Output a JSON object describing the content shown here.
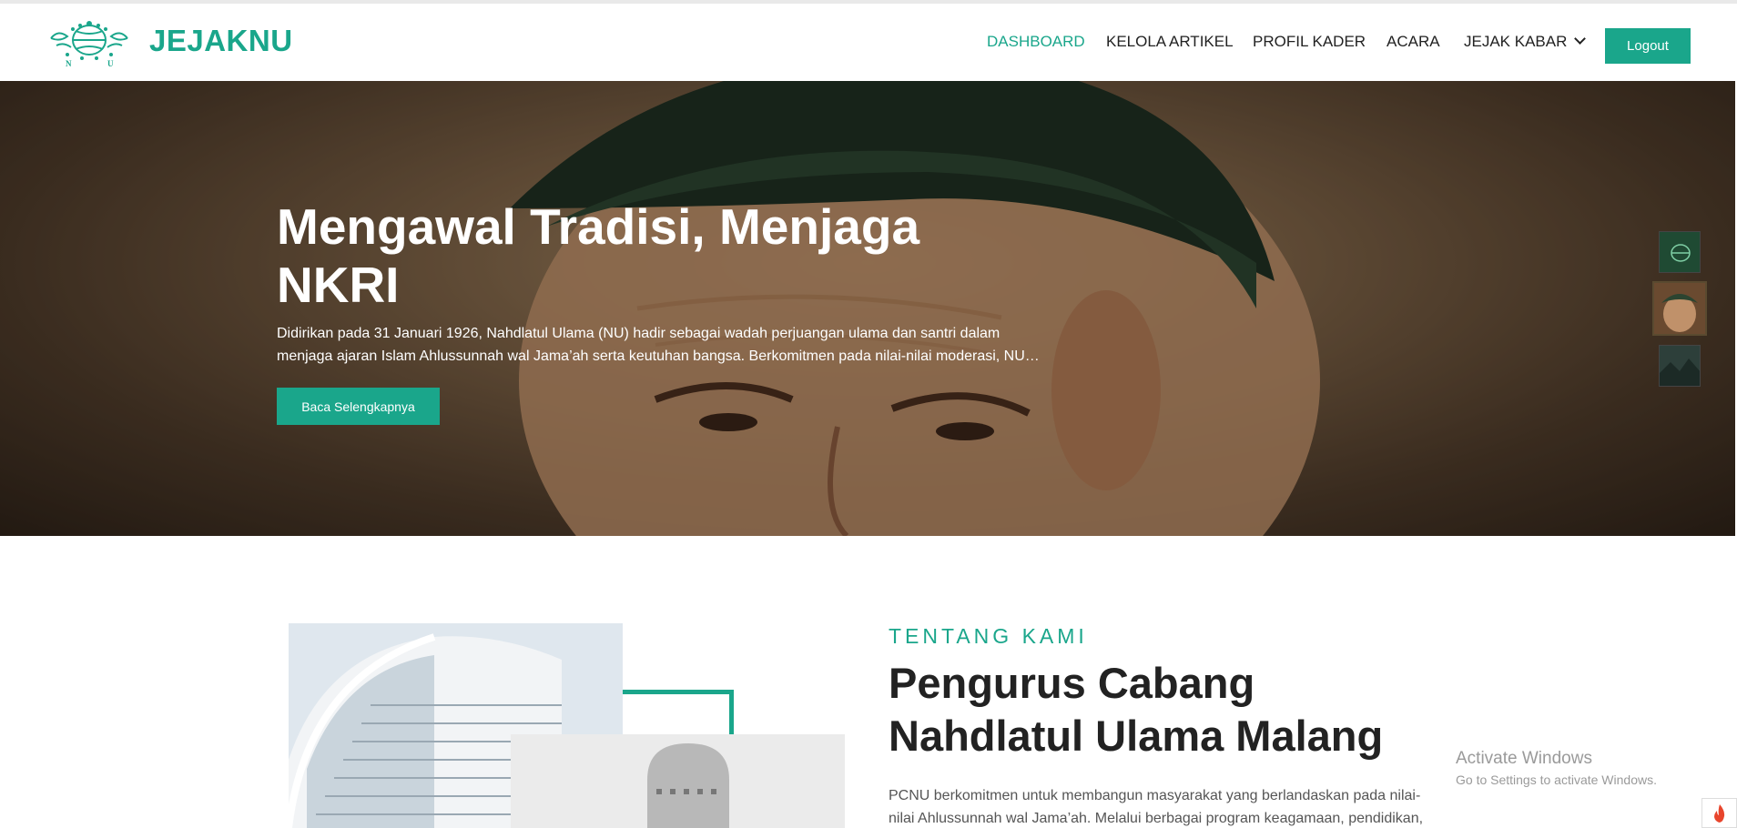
{
  "navbar": {
    "brand": "JEJAKNU",
    "logo_icon": "nu-logo-icon",
    "items": [
      {
        "label": "DASHBOARD",
        "active": true
      },
      {
        "label": "KELOLA ARTIKEL",
        "active": false
      },
      {
        "label": "PROFIL KADER",
        "active": false
      },
      {
        "label": "ACARA",
        "active": false
      },
      {
        "label": "JEJAK KABAR",
        "active": false,
        "icon": "chevron-down-icon"
      }
    ],
    "logout_label": "Logout"
  },
  "hero": {
    "title": "Mengawal Tradisi, Menjaga NKRI",
    "description": "Didirikan pada 31 Januari 1926, Nahdlatul Ulama (NU) hadir sebagai wadah perjuangan ulama dan santri dalam menjaga ajaran Islam Ahlussunnah wal Jama’ah serta keutuhan bangsa. Berkomitmen pada nilai-nilai moderasi, NU…",
    "button_label": "Baca Selengkapnya",
    "thumbnails": [
      "nu-logo-thumb",
      "portrait-thumb",
      "landscape-thumb"
    ],
    "active_thumbnail": 1
  },
  "about": {
    "label": "TENTANG KAMI",
    "title": "Pengurus Cabang Nahdlatul Ulama Malang",
    "text": "PCNU berkomitmen untuk membangun masyarakat yang berlandaskan pada nilai-nilai Ahlussunnah wal Jama’ah. Melalui berbagai program keagamaan, pendidikan,"
  },
  "watermark": {
    "line1": "Activate Windows",
    "line2": "Go to Settings to activate Windows."
  },
  "colors": {
    "accent": "#1aa68b",
    "text_dark": "#222222",
    "text_muted": "#555555"
  }
}
